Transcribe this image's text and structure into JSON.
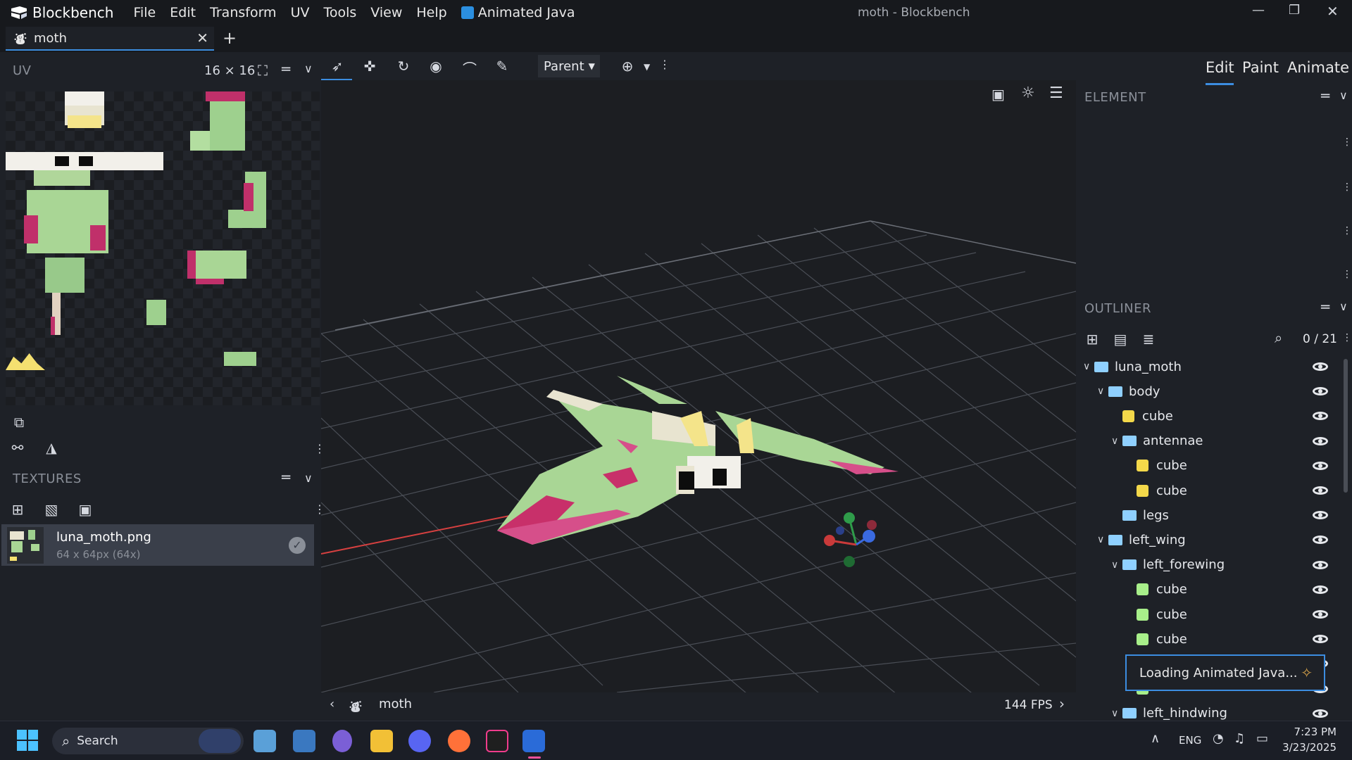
{
  "app": {
    "name": "Blockbench",
    "window_title": "moth - Blockbench",
    "menu": [
      "File",
      "Edit",
      "Transform",
      "UV",
      "Tools",
      "View",
      "Help"
    ],
    "plugin_menu": "Animated Java"
  },
  "tabs": {
    "active": "moth"
  },
  "uv_panel": {
    "title": "UV",
    "grid_size": "16 × 16"
  },
  "textures_panel": {
    "title": "TEXTURES",
    "items": [
      {
        "name": "luna_moth.png",
        "info": "64 x 64px (64x)"
      }
    ]
  },
  "toolbar": {
    "pivot_mode": "Parent"
  },
  "viewport": {
    "model_name": "moth",
    "fps": "144 FPS"
  },
  "modes": {
    "edit": "Edit",
    "paint": "Paint",
    "animate": "Animate",
    "active": "Edit"
  },
  "element_panel": {
    "title": "ELEMENT"
  },
  "outliner": {
    "title": "OUTLINER",
    "count": "0 / 21",
    "rows": [
      {
        "label": "luna_moth",
        "type": "folder",
        "depth": 0,
        "expanded": true
      },
      {
        "label": "body",
        "type": "folder",
        "depth": 1,
        "expanded": true
      },
      {
        "label": "cube",
        "type": "cube",
        "depth": 2,
        "color": "#f3d84a"
      },
      {
        "label": "antennae",
        "type": "folder",
        "depth": 2,
        "expanded": true
      },
      {
        "label": "cube",
        "type": "cube",
        "depth": 3,
        "color": "#f3d84a"
      },
      {
        "label": "cube",
        "type": "cube",
        "depth": 3,
        "color": "#f3d84a"
      },
      {
        "label": "legs",
        "type": "folder",
        "depth": 2,
        "expanded": false
      },
      {
        "label": "left_wing",
        "type": "folder",
        "depth": 1,
        "expanded": true
      },
      {
        "label": "left_forewing",
        "type": "folder",
        "depth": 2,
        "expanded": true
      },
      {
        "label": "cube",
        "type": "cube",
        "depth": 3,
        "color": "#a8ef8a"
      },
      {
        "label": "cube",
        "type": "cube",
        "depth": 3,
        "color": "#a8ef8a"
      },
      {
        "label": "cube",
        "type": "cube",
        "depth": 3,
        "color": "#a8ef8a"
      },
      {
        "label": "",
        "type": "cube",
        "depth": 3,
        "color": "#a8ef8a"
      },
      {
        "label": "",
        "type": "cube",
        "depth": 3,
        "color": "#a8ef8a"
      },
      {
        "label": "left_hindwing",
        "type": "folder",
        "depth": 2,
        "expanded": true
      }
    ]
  },
  "toast": {
    "text": "Loading Animated Java..."
  },
  "taskbar": {
    "search_placeholder": "Search",
    "language": "ENG",
    "time": "7:23 PM",
    "date": "3/23/2025"
  },
  "colors": {
    "accent": "#3c8de0",
    "folder": "#8fd0ff",
    "cube_yellow": "#f3d84a",
    "cube_green": "#a8ef8a"
  }
}
